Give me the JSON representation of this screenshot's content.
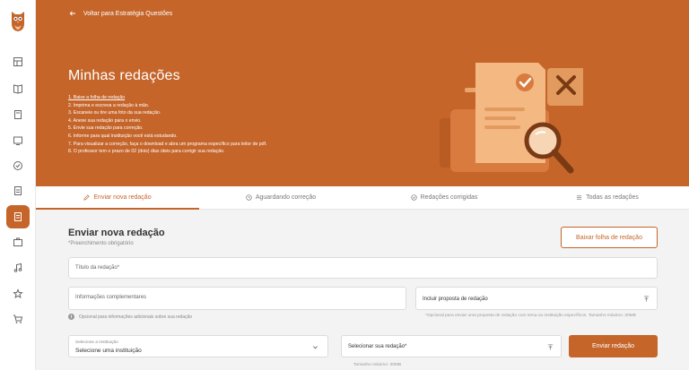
{
  "colors": {
    "accent": "#c5652a",
    "background": "#f3f3f3"
  },
  "sidebar": {
    "items": [
      {
        "name": "dashboard-icon",
        "active": false
      },
      {
        "name": "book-icon",
        "active": false
      },
      {
        "name": "notebook-icon",
        "active": false
      },
      {
        "name": "monitor-icon",
        "active": false
      },
      {
        "name": "check-badge-icon",
        "active": false
      },
      {
        "name": "document-icon",
        "active": false
      },
      {
        "name": "essay-icon",
        "active": true
      },
      {
        "name": "briefcase-icon",
        "active": false
      },
      {
        "name": "music-icon",
        "active": false
      },
      {
        "name": "star-icon",
        "active": false
      },
      {
        "name": "cart-icon",
        "active": false
      }
    ]
  },
  "hero": {
    "back_label": "Voltar para Estratégia Questões",
    "title": "Minhas redações",
    "steps": [
      "1. Baixe a folha de redação",
      "2. Imprima e escreva a redação à mão.",
      "3. Escaneie ou tire uma foto da sua redação.",
      "4. Anexe sua redação para o envio.",
      "5. Envie sua redação para correção.",
      "6. Informe para qual instituição você está estudando.",
      "7. Para visualizar a correção, faça o download e abra um programa específico para leitor de pdf.",
      "8. O professor tem o prazo de 02 (dois) dias úteis para corrigir sua redação."
    ]
  },
  "tabs": [
    {
      "label": "Enviar nova redação",
      "icon": "pencil-icon",
      "active": true
    },
    {
      "label": "Aguardando correção",
      "icon": "clock-icon",
      "active": false
    },
    {
      "label": "Redações corrigidas",
      "icon": "check-circle-icon",
      "active": false
    },
    {
      "label": "Todas as redações",
      "icon": "list-icon",
      "active": false
    }
  ],
  "form": {
    "title": "Enviar nova redação",
    "required_note": "*Preenchimento obrigatório",
    "download_button": "Baixar folha de redação",
    "title_field_label": "Título da redação*",
    "info_field_label": "Informações complementares",
    "info_hint": "Opcional para informações adicionais sobre sua redação",
    "proposal_field_label": "Incluir proposta de redação",
    "proposal_hint": "*Opcional para enviar uma proposta de redação com tema ou instituição específicos. Tamanho máximo: 30MB",
    "institution_small_label": "Selecione a instituição",
    "institution_value": "Selecione uma instituição",
    "upload_label": "Selecionar sua redação*",
    "submit_button": "Enviar redação",
    "max_size": "Tamanho máximo: 30MB"
  }
}
